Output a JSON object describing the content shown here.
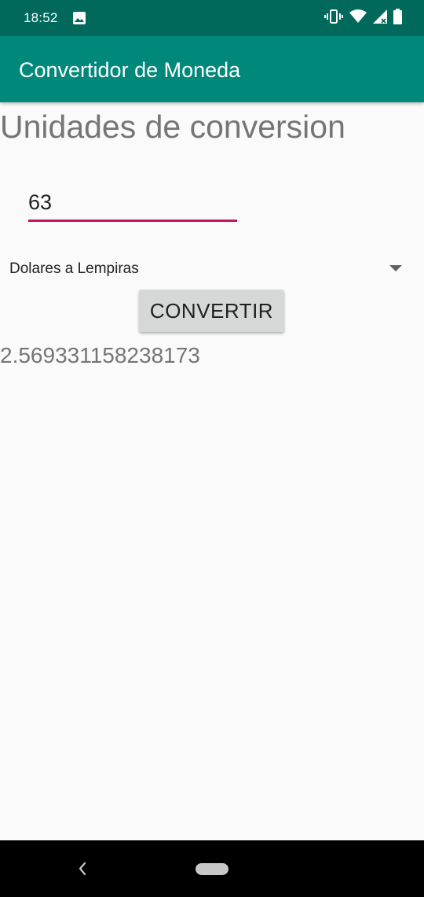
{
  "status_bar": {
    "time": "18:52",
    "icons": [
      "gallery-icon",
      "vibrate-icon",
      "wifi-icon",
      "signal-icon",
      "battery-icon"
    ]
  },
  "app_bar": {
    "title": "Convertidor de Moneda"
  },
  "main": {
    "heading": "Unidades de conversion",
    "amount_value": "63",
    "conversion_selected": "Dolares a Lempiras",
    "convert_label": "CONVERTIR",
    "result": "2.569331158238173"
  },
  "nav_bar": {
    "icons": [
      "back-icon",
      "home-pill-icon"
    ]
  },
  "colors": {
    "status_bar": "#00695c",
    "app_bar": "#00897b",
    "input_underline": "#c2185b",
    "background": "#fafafa",
    "button": "#d6d7d7"
  }
}
